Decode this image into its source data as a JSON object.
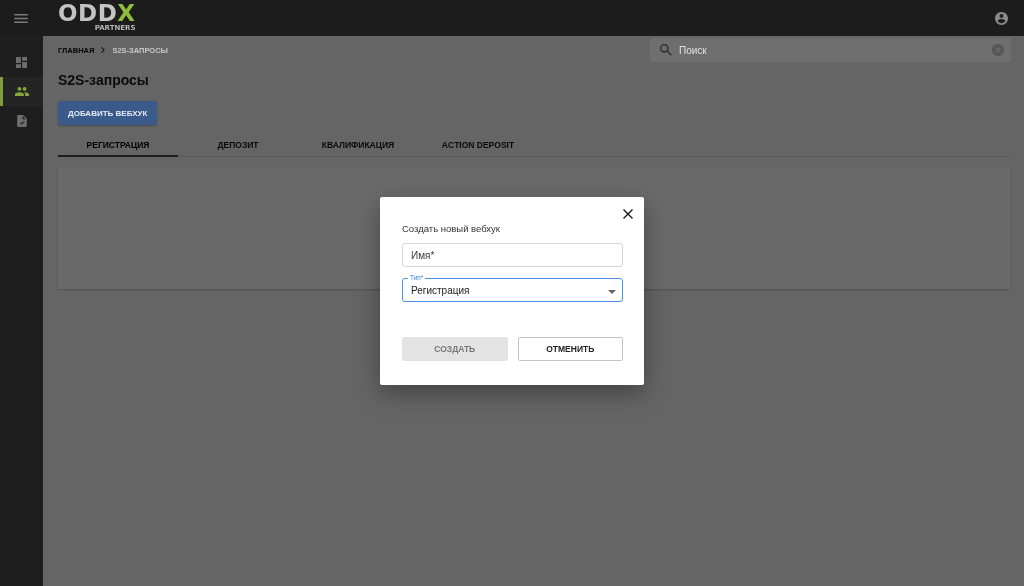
{
  "topbar": {
    "logo": {
      "wordmark": "ODD",
      "wordmark_accent": "X",
      "tagline": "PARTNERS"
    }
  },
  "sidebar": {
    "items": [
      {
        "selected": false
      },
      {
        "selected": true
      },
      {
        "selected": false
      }
    ]
  },
  "breadcrumb": [
    {
      "label": "ГЛАВНАЯ",
      "current": false
    },
    {
      "label": "S2S-ЗАПРОСЫ",
      "current": true
    }
  ],
  "search": {
    "placeholder": "Поиск"
  },
  "page": {
    "title": "S2S-запросы",
    "add_button": "ДОБАВИТЬ ВЕБХУК"
  },
  "tabs": [
    {
      "label": "РЕГИСТРАЦИЯ",
      "selected": true
    },
    {
      "label": "ДЕПОЗИТ",
      "selected": false
    },
    {
      "label": "КВАЛИФИКАЦИЯ",
      "selected": false
    },
    {
      "label": "ACTION DEPOSIT",
      "selected": false
    }
  ],
  "dialog": {
    "title": "Создать новый вебхук",
    "fields": [
      {
        "kind": "text",
        "placeholder": "Имя*",
        "focused": false
      },
      {
        "kind": "select",
        "label": "Тип*",
        "value": "Регистрация",
        "focused": true
      }
    ],
    "buttons": [
      {
        "label": "СОЗДАТЬ",
        "kind": "filled",
        "disabled": true
      },
      {
        "label": "ОТМЕНИТЬ",
        "kind": "outlined",
        "disabled": false
      }
    ]
  }
}
